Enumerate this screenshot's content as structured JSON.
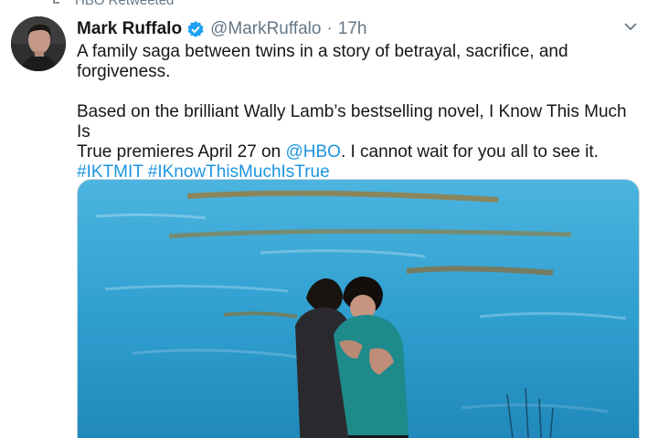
{
  "social_context": {
    "icon": "retweet-icon",
    "text": "HBO Retweeted"
  },
  "author": {
    "name": "Mark Ruffalo",
    "verified_icon": "verified-badge-icon",
    "handle": "@MarkRuffalo",
    "separator": "·",
    "time": "17h"
  },
  "menu": {
    "icon": "chevron-down-icon"
  },
  "tweet": {
    "line1": "A family saga between twins in a story of betrayal, sacrifice, and",
    "line2": "forgiveness.",
    "line3": "Based on the brilliant Wally Lamb’s bestselling novel, I Know This Much Is",
    "line4_before": "True premieres April 27 on ",
    "mention": "@HBO",
    "line4_after": ". I cannot wait for you all to see it.",
    "hashtag1": "#IKTMIT",
    "hashtag2": "#IKnowThisMuchIsTrue"
  },
  "colors": {
    "link": "#1b95e0",
    "verified": "#1da1f2",
    "secondary_text": "#657786",
    "water": "#3aa8d6",
    "jacket": "#1f8a8a"
  }
}
